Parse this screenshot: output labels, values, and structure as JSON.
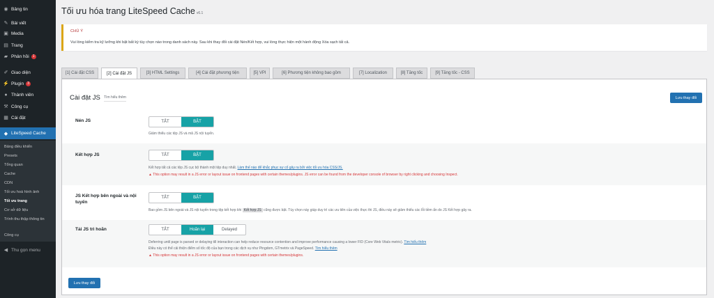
{
  "sidebar": {
    "items": [
      {
        "label": "Bảng tin",
        "icon": "dashboard-icon"
      },
      {
        "label": "Bài viết",
        "icon": "pin-icon"
      },
      {
        "label": "Media",
        "icon": "media-icon"
      },
      {
        "label": "Trang",
        "icon": "page-icon"
      },
      {
        "label": "Phản hồi",
        "icon": "comment-icon",
        "badge": "1"
      },
      {
        "label": "Giao diện",
        "icon": "appearance-icon"
      },
      {
        "label": "Plugin",
        "icon": "plugin-icon",
        "badge": "3"
      },
      {
        "label": "Thành viên",
        "icon": "users-icon"
      },
      {
        "label": "Công cụ",
        "icon": "tools-icon"
      },
      {
        "label": "Cài đặt",
        "icon": "settings-icon"
      },
      {
        "label": "LiteSpeed Cache",
        "icon": "litespeed-icon"
      },
      {
        "label": "Thu gọn menu",
        "icon": "collapse-icon"
      }
    ],
    "submenu": [
      "Bảng điều khiển",
      "Presets",
      "Tổng quan",
      "Cache",
      "CDN",
      "Tối ưu hoá hình ảnh",
      "Tối ưu trang",
      "Cơ sở dữ liệu",
      "Trình thu thập thông tin",
      "Công cụ"
    ]
  },
  "page": {
    "title": "Tối ưu hóa trang LiteSpeed Cache",
    "version": "v6.1"
  },
  "notice": {
    "title": "CHÚ Ý",
    "text": "Vui lòng kiểm tra kỹ lưỡng khi bật bất kỳ tùy chọn nào trong danh sách này. Sau khi thay đổi cài đặt Nén/Kết hợp, vui lòng thực hiện một hành động Xóa sạch tất cả."
  },
  "tabs": [
    "[1] Cài đặt CSS",
    "[2] Cài đặt JS",
    "[3] HTML Settings",
    "[4] Cài đặt phương tiện",
    "[5] VPI",
    "[6] Phương tiện không bao gồm",
    "[7] Localization",
    "[8] Tăng tốc",
    "[9] Tăng tốc - CSS"
  ],
  "section": {
    "title": "Cài đặt JS",
    "learn_more": "Tìm hiểu thêm",
    "save_top": "Lưu thay đổi",
    "save_bottom": "Lưu thay đổi"
  },
  "settings": {
    "minify": {
      "label": "Nén JS",
      "off": "TẮT",
      "on": "BẬT",
      "value": "BẬT",
      "desc": "Giảm thiểu các tệp JS và mã JS nội tuyến."
    },
    "combine": {
      "label": "Kết hợp JS",
      "off": "TẮT",
      "on": "BẬT",
      "value": "BẬT",
      "desc": "Kết hợp tất cả các tệp JS cục bộ thành một tệp duy nhất.",
      "link": "Làm thế nào để khắc phục sự cố gây ra bởi việc tối ưu hóa CSS/JS.",
      "warn": "This option may result in a JS error or layout issue on frontend pages with certain themes/plugins. JS error can be found from the developer console of browser by right clicking and choosing Inspect."
    },
    "external_inline": {
      "label": "JS Kết hợp bên ngoài và nội tuyến",
      "off": "TẮT",
      "on": "BẬT",
      "value": "BẬT",
      "desc_pre": "Bao gồm JS bên ngoài và JS nội tuyến trong tệp kết hợp khi",
      "code": "Kết hợp JS",
      "desc_post": "cũng được bật. Tùy chọn này giúp duy trì các ưu tiên của việc thực thi JS, điều này sẽ giảm thiểu các lỗi tiềm ẩn do JS Kết hợp gây ra."
    },
    "defer": {
      "label": "Tải JS trì hoãn",
      "off": "TẮT",
      "deferred": "Hoãn lại",
      "delayed": "Delayed",
      "value": "Hoãn lại",
      "desc1": "Deferring until page is parsed or delaying till interaction can help reduce resource contention and improve performance causing a lower FID (Core Web Vitals metric).",
      "link1": "Tìm hiểu thêm",
      "desc2": "Điều này có thể cải thiện điểm số tốc độ của bạn trong các dịch vụ như Pingdom, GTmetrix và PageSpeed.",
      "link2": "Tìm hiểu thêm",
      "warn": "This option may result in a JS error or layout issue on frontend pages with certain themes/plugins."
    }
  },
  "colors": {
    "sidebar_bg": "#1d2327",
    "accent": "#2271b1",
    "toggle_on": "#17a2a6",
    "warning": "#d63638",
    "notice_border": "#dba617"
  }
}
